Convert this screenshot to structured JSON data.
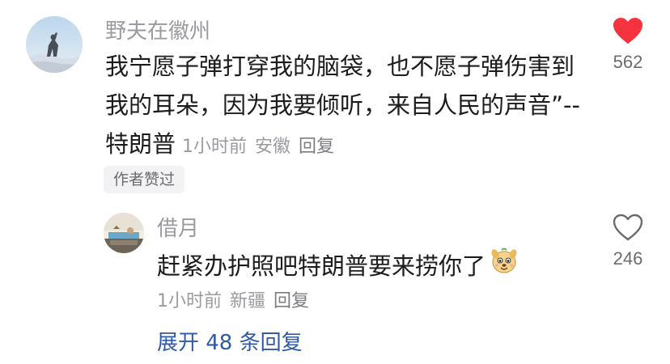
{
  "comment": {
    "username": "野夫在徽州",
    "lines": [
      "我宁愿子弹打穿我的脑袋，也不愿子弹伤害到",
      "我的耳朵，因为我要倾听，来自人民的声音”--",
      "特朗普"
    ],
    "time": "1小时前",
    "location": "安徽",
    "reply_label": "回复",
    "badge": "作者赞过",
    "like_count": "562",
    "liked": true
  },
  "reply": {
    "username": "借月",
    "text": "赶紧办护照吧特朗普要来捞你了",
    "emoji_icon": "puppy-face-emoji-icon",
    "time": "1小时前",
    "location": "新疆",
    "reply_label": "回复",
    "like_count": "246",
    "liked": false
  },
  "expand_replies": "展开 48 条回复",
  "colors": {
    "liked_heart": "#f5333f",
    "link": "#2f5aa8",
    "muted_text": "#9a9aa0",
    "body_text": "#1c1c1e"
  }
}
